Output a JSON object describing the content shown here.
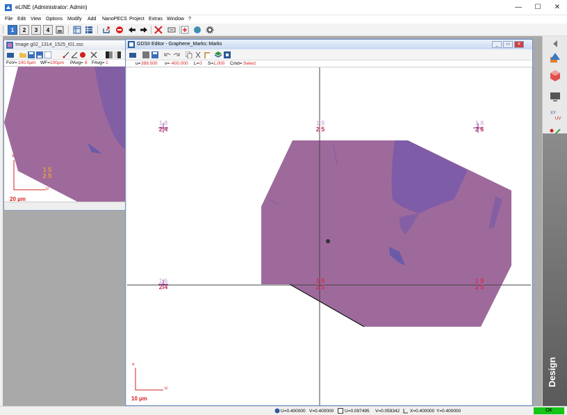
{
  "app": {
    "title": "eLINE (Administrator: Admin)"
  },
  "window_controls": {
    "minimize": "—",
    "maximize": "☐",
    "close": "✕"
  },
  "menu": [
    "File",
    "Edit",
    "View",
    "Options",
    "Modify",
    "Add",
    "NanoPECS",
    "Project",
    "Extras",
    "Window",
    "?"
  ],
  "toolbar": {
    "view_buttons": [
      "1",
      "2",
      "3",
      "4"
    ],
    "icons": [
      "layout-icon",
      "table-icon",
      "grid-icon",
      "export-icon",
      "stop-icon",
      "back-arrow-icon",
      "forward-arrow-icon",
      "cross-icon",
      "stage-icon",
      "target-icon",
      "globe-icon",
      "settings-icon"
    ]
  },
  "image_window": {
    "title": "Image g02_1314_1525_t01.ssc",
    "info": {
      "fov_label": "FoV=",
      "fov": "100.0µm",
      "wf_label": "WF=",
      "wf": "100µm",
      "pavg_label": "PAvg=",
      "pavg": "8",
      "favg_label": "FAvg=",
      "favg": "1"
    },
    "mark_top": "1 5",
    "mark_bottom": "2 5",
    "axis_v": "v",
    "axis_u": "u",
    "scale": "20 µm"
  },
  "gds_window": {
    "title": "GDSII Editor - Graphene_Marks::Marks",
    "info": {
      "u_label": "u=",
      "u": "399.000",
      "v_label": "v=",
      "v": "-400.000",
      "l_label": "L=",
      "l": "0",
      "s_label": "S=",
      "s": "1.000",
      "cmd_label": "Cmd=",
      "cmd": "Select"
    },
    "marks": [
      {
        "top": "1 8",
        "bottom": "2 4"
      },
      {
        "top": "1 8",
        "bottom": "2 5"
      },
      {
        "top": "1 8",
        "bottom": "2 6"
      },
      {
        "top": "1 6",
        "bottom": "2 4"
      },
      {
        "top": "1 5",
        "bottom": "2 5"
      },
      {
        "top": "1 5",
        "bottom": "2 5"
      }
    ],
    "axis_v": "v",
    "axis_u": "u",
    "scale": "10 µm"
  },
  "right_panel": {
    "label": "Design"
  },
  "status": {
    "u": "U=0.400000",
    "v": "V=0.400000",
    "u2": "U=0.097495",
    "v2": "V=0.059342",
    "x": "X=0.400000",
    "y": "Y=0.400000",
    "ok": "OK"
  }
}
